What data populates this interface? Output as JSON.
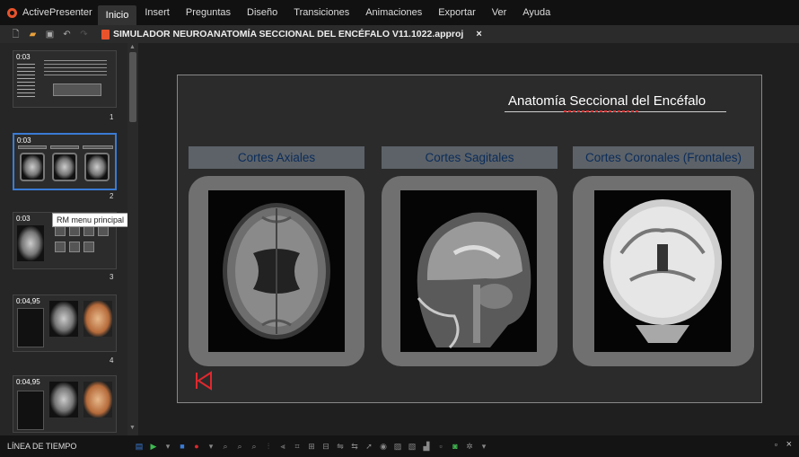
{
  "app": {
    "name": "ActivePresenter",
    "brand_color": "#e8532c"
  },
  "menu": [
    "Inicio",
    "Insert",
    "Preguntas",
    "Diseño",
    "Transiciones",
    "Animaciones",
    "Exportar",
    "Ver",
    "Ayuda"
  ],
  "document": {
    "tab_title": "SIMULADOR NEUROANATOMÍA SECCIONAL DEL ENCÉFALO V11.1022.approj",
    "close": "×"
  },
  "sidebar": {
    "slides": [
      {
        "time": "0:03",
        "num": "1"
      },
      {
        "time": "0:03",
        "num": "2",
        "tooltip": "RM menu principal"
      },
      {
        "time": "0:03",
        "num": "3"
      },
      {
        "time": "0:04,95",
        "num": "4"
      },
      {
        "time": "0:04,95",
        "num": ""
      }
    ]
  },
  "slide": {
    "title": "Anatomía Seccional del Encéfalo",
    "categories": [
      "Cortes Axiales",
      "Cortes Sagitales",
      "Cortes Coronales (Frontales)"
    ],
    "accent": "#e0282e"
  },
  "statusbar": {
    "timeline_label": "LÍNEA DE TIEMPO",
    "pin": "▫",
    "close": "×"
  }
}
